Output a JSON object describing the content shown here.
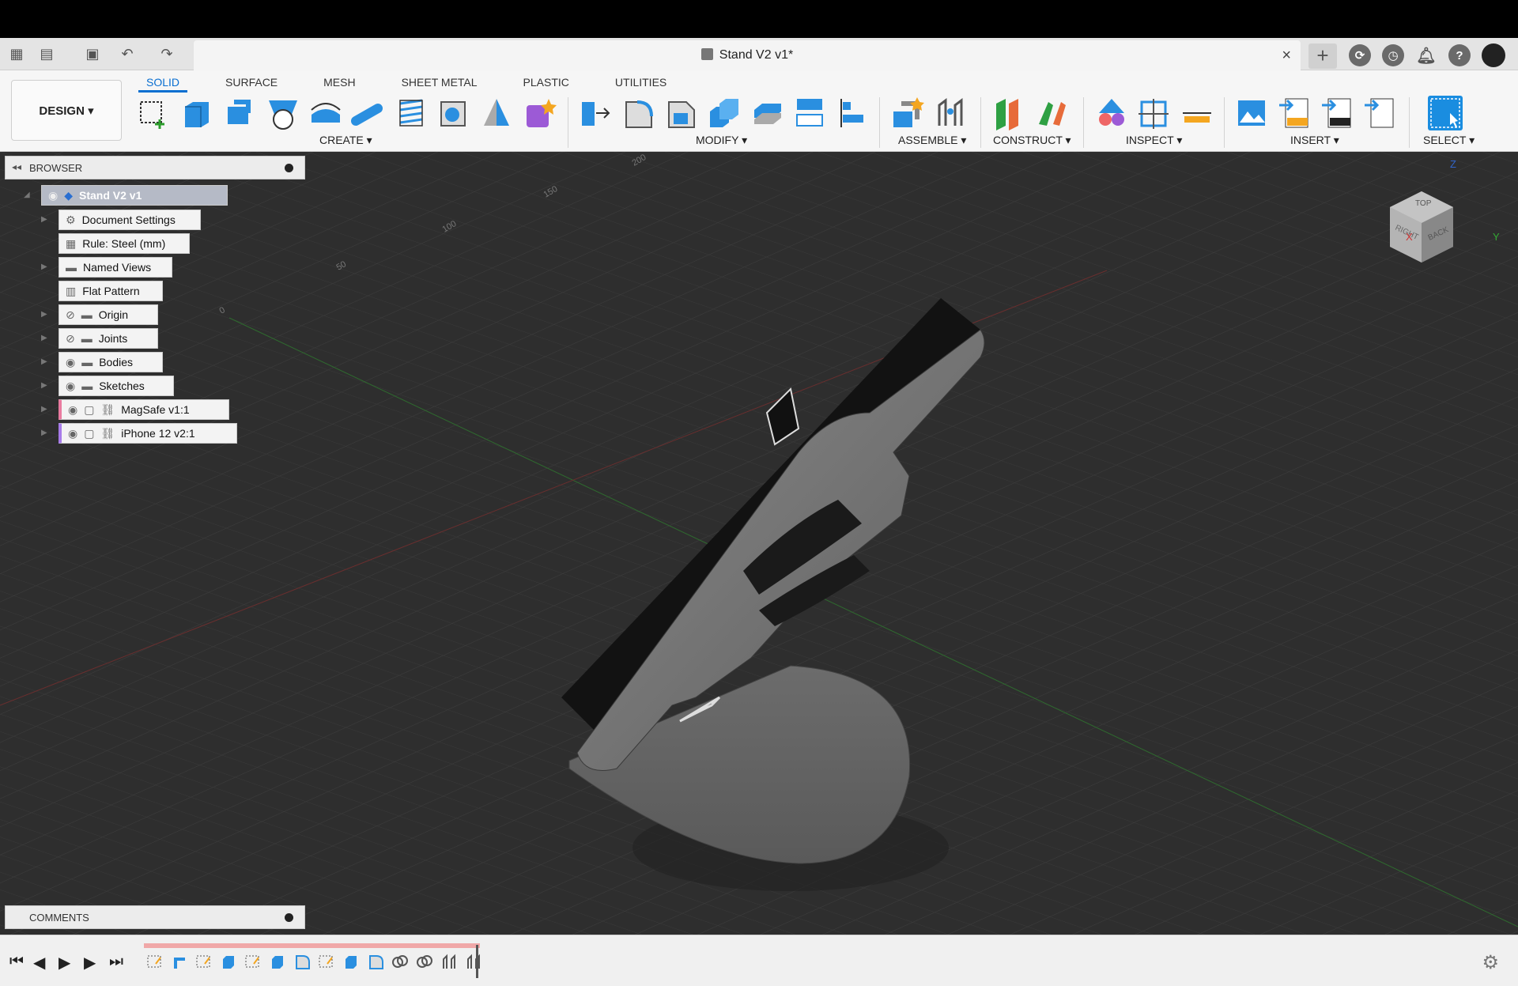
{
  "document": {
    "title": "Stand V2 v1*"
  },
  "workspace": {
    "mode_label": "DESIGN ▾",
    "tabs": [
      "SOLID",
      "SURFACE",
      "MESH",
      "SHEET METAL",
      "PLASTIC",
      "UTILITIES"
    ],
    "active_tab": "SOLID",
    "groups": [
      "CREATE ▾",
      "MODIFY ▾",
      "ASSEMBLE ▾",
      "CONSTRUCT ▾",
      "INSPECT ▾",
      "INSERT ▾",
      "SELECT ▾"
    ]
  },
  "browser": {
    "label": "BROWSER",
    "root": "Stand V2 v1",
    "items": [
      {
        "label": "Document Settings",
        "icon": "gear-icon"
      },
      {
        "label": "Rule: Steel (mm)",
        "icon": "rule-icon"
      },
      {
        "label": "Named Views",
        "icon": "folder-icon"
      },
      {
        "label": "Flat Pattern",
        "icon": "flat-pattern-icon"
      },
      {
        "label": "Origin",
        "icon": "folder-icon"
      },
      {
        "label": "Joints",
        "icon": "folder-icon"
      },
      {
        "label": "Bodies",
        "icon": "folder-icon"
      },
      {
        "label": "Sketches",
        "icon": "folder-icon"
      },
      {
        "label": "MagSafe v1:1",
        "icon": "link-icon"
      },
      {
        "label": "iPhone 12 v2:1",
        "icon": "link-icon"
      }
    ]
  },
  "comments": {
    "label": "COMMENTS"
  },
  "viewcube": {
    "top": "TOP",
    "right": "RIGHT",
    "back": "BACK",
    "x": "X",
    "y": "Y",
    "z": "Z"
  },
  "grid_labels": [
    "0",
    "50",
    "100",
    "150",
    "200"
  ],
  "colors": {
    "accent": "#0a6fd1",
    "viewport": "#2e2e2e",
    "timeline_track": "#f0a8a8"
  }
}
